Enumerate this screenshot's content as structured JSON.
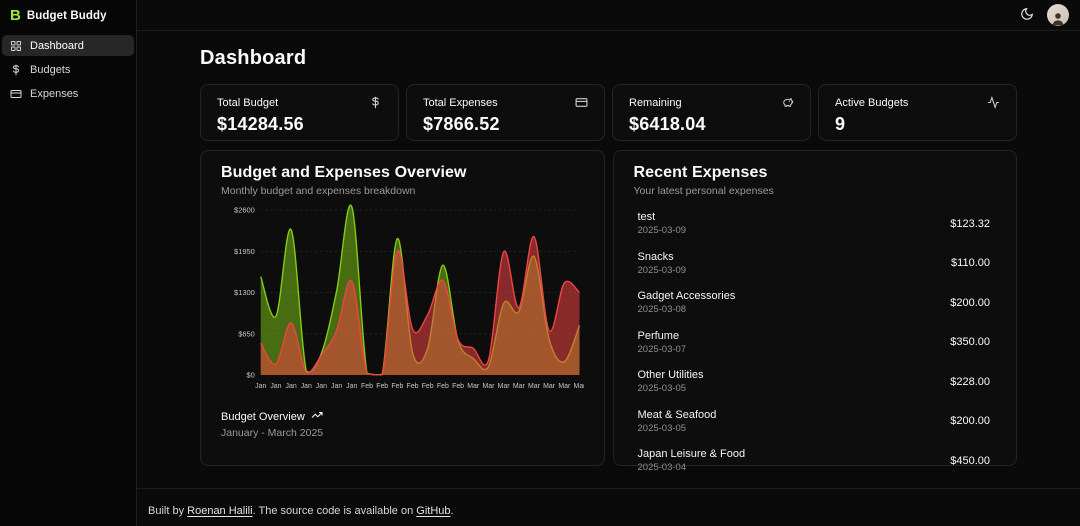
{
  "app": {
    "name": "Budget Buddy",
    "logo_letter": "B",
    "brand_color": "#a3e635"
  },
  "sidebar": {
    "items": [
      {
        "label": "Dashboard",
        "icon": "layout-grid-icon",
        "active": true
      },
      {
        "label": "Budgets",
        "icon": "dollar-sign-icon",
        "active": false
      },
      {
        "label": "Expenses",
        "icon": "credit-card-icon",
        "active": false
      }
    ]
  },
  "topbar": {
    "theme_toggle_icon": "moon-icon",
    "avatar_icon": "user-avatar"
  },
  "page": {
    "title": "Dashboard"
  },
  "stats": [
    {
      "label": "Total Budget",
      "value": "$14284.56",
      "icon": "dollar-sign-icon"
    },
    {
      "label": "Total Expenses",
      "value": "$7866.52",
      "icon": "credit-card-icon"
    },
    {
      "label": "Remaining",
      "value": "$6418.04",
      "icon": "piggy-bank-icon"
    },
    {
      "label": "Active Budgets",
      "value": "9",
      "icon": "activity-icon"
    }
  ],
  "overview": {
    "title": "Budget and Expenses Overview",
    "subtitle": "Monthly budget and expenses breakdown",
    "footer_label": "Budget Overview",
    "footer_icon": "trending-up-icon",
    "footer_period": "January - March 2025"
  },
  "chart_data": {
    "type": "area",
    "title": "Budget and Expenses Overview",
    "categories": [
      "Jan",
      "Jan",
      "Jan",
      "Jan",
      "Jan",
      "Jan",
      "Jan",
      "Feb",
      "Feb",
      "Feb",
      "Feb",
      "Feb",
      "Feb",
      "Feb",
      "Mar",
      "Mar",
      "Mar",
      "Mar",
      "Mar",
      "Mar",
      "Mar",
      "Mar"
    ],
    "series": [
      {
        "name": "Budget",
        "color": "#84cc16",
        "fill": "rgba(132,204,22,0.5)",
        "values": [
          1550,
          925,
          2290,
          60,
          340,
          1320,
          2650,
          30,
          10,
          2150,
          350,
          420,
          1730,
          540,
          260,
          130,
          1130,
          1000,
          1870,
          560,
          210,
          780
        ]
      },
      {
        "name": "Expenses",
        "color": "#ef4444",
        "fill": "rgba(239,68,68,0.55)",
        "values": [
          505,
          170,
          820,
          40,
          310,
          700,
          1480,
          20,
          5,
          1950,
          720,
          950,
          1490,
          560,
          420,
          230,
          1940,
          1060,
          2180,
          700,
          1450,
          1300
        ]
      }
    ],
    "ylim": [
      0,
      2600
    ],
    "yticks": [
      0,
      650,
      1300,
      1950,
      2600
    ],
    "ytick_labels": [
      "$0",
      "$650",
      "$1300",
      "$1950",
      "$2600"
    ],
    "grid": "dotted-horizontal",
    "legend": "none"
  },
  "recent": {
    "title": "Recent Expenses",
    "subtitle": "Your latest personal expenses",
    "items": [
      {
        "name": "test",
        "date": "2025-03-09",
        "amount": "$123.32"
      },
      {
        "name": "Snacks",
        "date": "2025-03-09",
        "amount": "$110.00"
      },
      {
        "name": "Gadget Accessories",
        "date": "2025-03-08",
        "amount": "$200.00"
      },
      {
        "name": "Perfume",
        "date": "2025-03-07",
        "amount": "$350.00"
      },
      {
        "name": "Other Utilities",
        "date": "2025-03-05",
        "amount": "$228.00"
      },
      {
        "name": "Meat & Seafood",
        "date": "2025-03-05",
        "amount": "$200.00"
      },
      {
        "name": "Japan Leisure & Food",
        "date": "2025-03-04",
        "amount": "$450.00"
      }
    ]
  },
  "footer": {
    "prefix": "Built by ",
    "author_link": "Roenan Halili",
    "middle": ". The source code is available on ",
    "repo_link": "GitHub",
    "suffix": "."
  }
}
